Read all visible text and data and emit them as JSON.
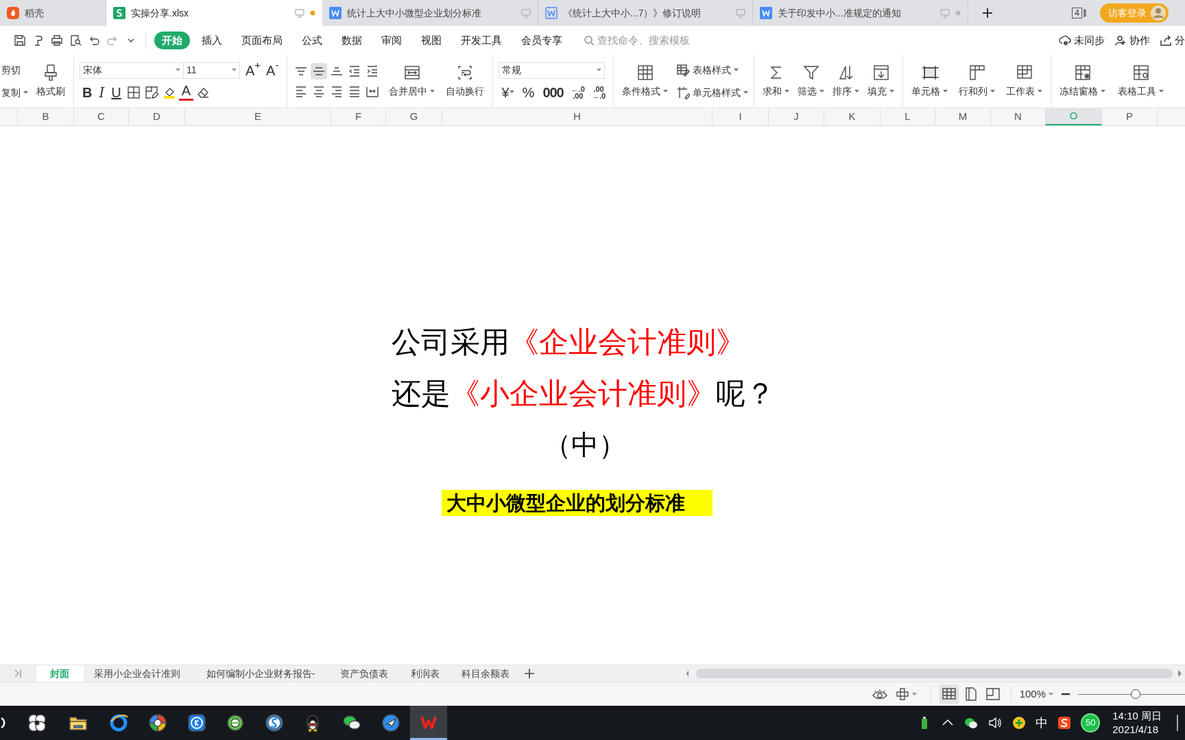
{
  "doc_tabs": [
    {
      "title": "稻壳",
      "kind": "docer",
      "selected": false,
      "unsaved": false,
      "monitor": false
    },
    {
      "title": "实操分享.xlsx",
      "kind": "sheet",
      "selected": true,
      "unsaved": true,
      "monitor": true
    },
    {
      "title": "统计上大中小微型企业划分标准",
      "kind": "word",
      "selected": false,
      "unsaved": false,
      "monitor": true
    },
    {
      "title": "《统计上大中小...7）》修订说明",
      "kind": "word_outline",
      "selected": false,
      "unsaved": false,
      "monitor": true
    },
    {
      "title": "关于印发中小...准规定的通知",
      "kind": "word",
      "selected": false,
      "unsaved": true,
      "monitor": true
    }
  ],
  "window_count": "4",
  "login_button": "访客登录",
  "menu_tabs": [
    {
      "label": "开始",
      "selected": true
    },
    {
      "label": "插入",
      "selected": false
    },
    {
      "label": "页面布局",
      "selected": false
    },
    {
      "label": "公式",
      "selected": false
    },
    {
      "label": "数据",
      "selected": false
    },
    {
      "label": "审阅",
      "selected": false
    },
    {
      "label": "视图",
      "selected": false
    },
    {
      "label": "开发工具",
      "selected": false
    },
    {
      "label": "会员专享",
      "selected": false
    }
  ],
  "search": {
    "placeholder": "查找命令、搜索模板"
  },
  "right_actions": [
    "未同步",
    "协作",
    "分"
  ],
  "ribbon": {
    "clipboard": {
      "small": [
        {
          "label": "剪切",
          "dropdown": false
        },
        {
          "label": "复制",
          "dropdown": true
        }
      ],
      "big": [
        {
          "label": "格式刷",
          "dropdown": false
        }
      ]
    },
    "font": {
      "family": "宋体",
      "size": "11",
      "grow": "A$^{+}$",
      "shrink": "A$^{-}$",
      "bold": "B",
      "italic": "I",
      "underline": "U",
      "font_color": "A"
    },
    "align": {
      "valign": [
        {
          "selected": false
        },
        {
          "selected": true
        },
        {
          "selected": false
        }
      ],
      "big": [
        {
          "label": "合并居中",
          "dropdown": true
        },
        {
          "label": "自动换行",
          "dropdown": false
        }
      ]
    },
    "number": {
      "format": "常规",
      "currency": "¥",
      "percent": "%",
      "thousands": "000",
      "increase_decimal": [
        "←.0",
        ".00"
      ],
      "decrease_decimal": [
        ".00",
        "→.0"
      ]
    },
    "styles": {
      "big": [
        {
          "label": "条件格式",
          "dropdown": true
        }
      ],
      "small": [
        {
          "label": "表格样式",
          "dropdown": true
        },
        {
          "label": "单元格样式",
          "dropdown": true
        }
      ]
    },
    "editing": {
      "big": [
        {
          "label": "求和",
          "dropdown": true
        },
        {
          "label": "筛选",
          "dropdown": true
        },
        {
          "label": "排序",
          "dropdown": true
        },
        {
          "label": "填充",
          "dropdown": true
        }
      ]
    },
    "cells": {
      "big": [
        {
          "label": "单元格",
          "dropdown": true
        },
        {
          "label": "行和列",
          "dropdown": true
        },
        {
          "label": "工作表",
          "dropdown": true
        }
      ]
    },
    "view": {
      "big": [
        {
          "label": "冻结窗格",
          "dropdown": true
        },
        {
          "label": "表格工具",
          "dropdown": true
        }
      ]
    }
  },
  "columns": [
    {
      "label": "B",
      "selected": false
    },
    {
      "label": "C",
      "selected": false
    },
    {
      "label": "D",
      "selected": false
    },
    {
      "label": "E",
      "selected": false
    },
    {
      "label": "F",
      "selected": false
    },
    {
      "label": "G",
      "selected": false
    },
    {
      "label": "H",
      "selected": false
    },
    {
      "label": "I",
      "selected": false
    },
    {
      "label": "J",
      "selected": false
    },
    {
      "label": "K",
      "selected": false
    },
    {
      "label": "L",
      "selected": false
    },
    {
      "label": "M",
      "selected": false
    },
    {
      "label": "N",
      "selected": false
    },
    {
      "label": "O",
      "selected": true
    },
    {
      "label": "P",
      "selected": false
    }
  ],
  "content": {
    "lines": [
      {
        "segments": [
          {
            "text": "公司采用",
            "color": "#000000"
          },
          {
            "text": "《企业会计准则》",
            "color": "#ff0000"
          }
        ]
      },
      {
        "segments": [
          {
            "text": "还是",
            "color": "#000000"
          },
          {
            "text": "《小企业会计准则》",
            "color": "#ff0000"
          },
          {
            "text": "呢？",
            "color": "#000000"
          }
        ]
      }
    ],
    "part": "（中）",
    "highlight": "大中小微型企业的划分标准"
  },
  "sheet_tabs": [
    {
      "label": "封面",
      "selected": true
    },
    {
      "label": "采用小企业会计准则",
      "selected": false
    },
    {
      "label": "如何编制小企业财务报告-",
      "selected": false
    },
    {
      "label": "资产负债表",
      "selected": false
    },
    {
      "label": "利润表",
      "selected": false
    },
    {
      "label": "科目余额表",
      "selected": false
    }
  ],
  "status_bar": {
    "views": [
      {
        "selected": true
      },
      {
        "selected": false
      },
      {
        "selected": false
      }
    ],
    "zoom": "100%",
    "zoom_slider": {
      "level": 0.54
    }
  },
  "taskbar": {
    "apps": [
      {
        "selected": false
      },
      {
        "selected": false
      },
      {
        "selected": false
      },
      {
        "selected": false
      },
      {
        "selected": false
      },
      {
        "selected": false
      },
      {
        "selected": false
      },
      {
        "selected": false
      },
      {
        "selected": false
      },
      {
        "selected": false
      },
      {
        "selected": true
      }
    ],
    "ime": "中",
    "badge": "50",
    "time": "14:10 周日",
    "date": "2021/4/18"
  }
}
